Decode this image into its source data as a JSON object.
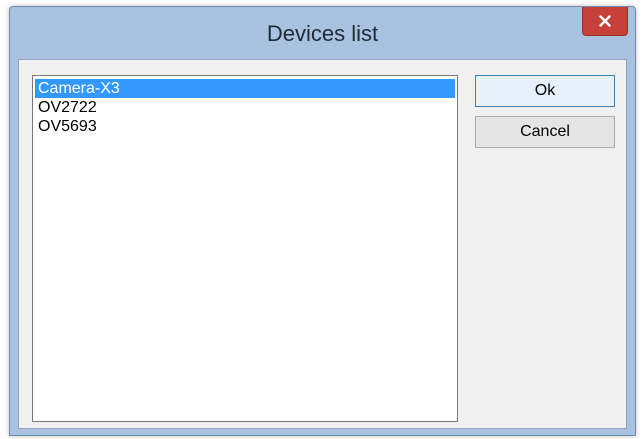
{
  "window": {
    "title": "Devices list",
    "close_icon": "close-icon"
  },
  "devices": {
    "items": [
      {
        "label": "Camera-X3",
        "selected": true
      },
      {
        "label": "OV2722",
        "selected": false
      },
      {
        "label": "OV5693",
        "selected": false
      }
    ]
  },
  "buttons": {
    "ok_label": "Ok",
    "cancel_label": "Cancel"
  },
  "colors": {
    "selection": "#3399ff",
    "close_button": "#c7413a",
    "frame": "#a9c2df"
  }
}
